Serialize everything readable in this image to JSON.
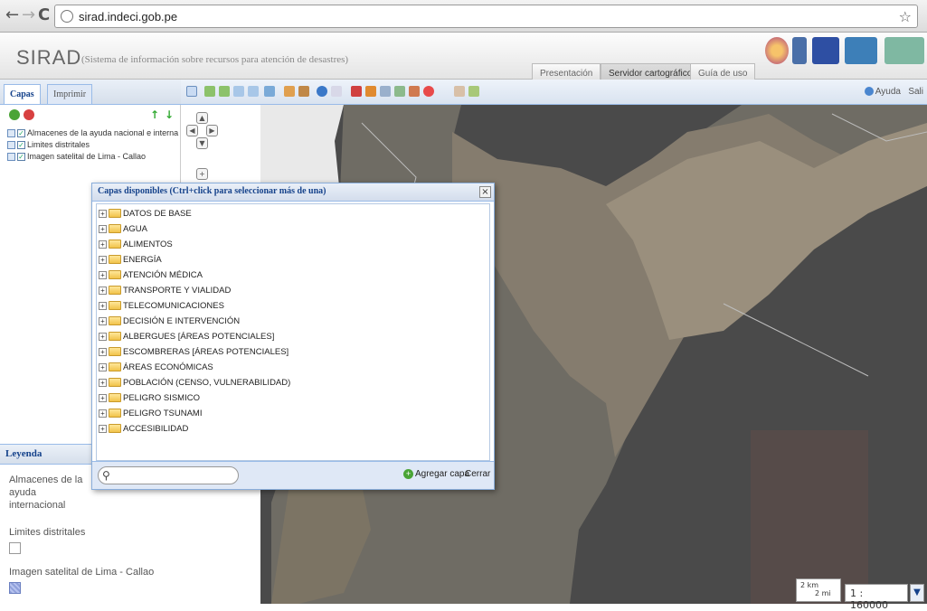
{
  "browser": {
    "url": "sirad.indeci.gob.pe",
    "back": "←",
    "forward": "→",
    "reload": "C",
    "star": "☆"
  },
  "header": {
    "logo": "SIRAD",
    "subtitle": "(Sistema de información sobre recursos para atención de desastres)",
    "tabs": [
      {
        "label": "Presentación"
      },
      {
        "label": "Servidor cartográfico"
      },
      {
        "label": "Guía de uso"
      }
    ]
  },
  "left_panel": {
    "tabs": [
      {
        "label": "Capas"
      },
      {
        "label": "Imprimir"
      }
    ],
    "layers": [
      {
        "label": "Almacenes de la ayuda nacional e interna",
        "checked": true
      },
      {
        "label": "Limites distritales",
        "checked": true
      },
      {
        "label": "Imagen satelital de Lima - Callao",
        "checked": true
      }
    ]
  },
  "legend": {
    "title": "Leyenda",
    "items": [
      {
        "label": "Almacenes de la ayuda internacional"
      },
      {
        "label": "Limites distritales"
      },
      {
        "label": "Imagen satelital de Lima - Callao"
      }
    ]
  },
  "toolbar": {
    "help": "Ayuda",
    "exit": "Sali"
  },
  "dialog": {
    "title": "Capas disponibles (Ctrl+click para seleccionar más de una)",
    "close": "×",
    "folders": [
      {
        "label": "DATOS DE BASE"
      },
      {
        "label": "AGUA"
      },
      {
        "label": "ALIMENTOS"
      },
      {
        "label": "ENERGÍA"
      },
      {
        "label": "ATENCIÓN MÉDICA"
      },
      {
        "label": "TRANSPORTE Y VIALIDAD"
      },
      {
        "label": "TELECOMUNICACIONES"
      },
      {
        "label": "DECISIÓN E INTERVENCIÓN"
      },
      {
        "label": "ALBERGUES [ÁREAS POTENCIALES]"
      },
      {
        "label": "ESCOMBRERAS [ÁREAS POTENCIALES]"
      },
      {
        "label": "ÁREAS ECONÓMICAS"
      },
      {
        "label": "POBLACIÓN (CENSO, VULNERABILIDAD)"
      },
      {
        "label": "PELIGRO SISMICO"
      },
      {
        "label": "PELIGRO TSUNAMI"
      },
      {
        "label": "ACCESIBILIDAD"
      }
    ],
    "search_value": "",
    "add_label": "Agregar capa",
    "close_label": "Cerrar"
  },
  "map": {
    "scale_top": "2 km",
    "scale_bottom": "2 mi",
    "scale_value": "1 : 160000"
  },
  "colors": {
    "accent": "#15428b",
    "map_bg": "#4a4a4a"
  }
}
